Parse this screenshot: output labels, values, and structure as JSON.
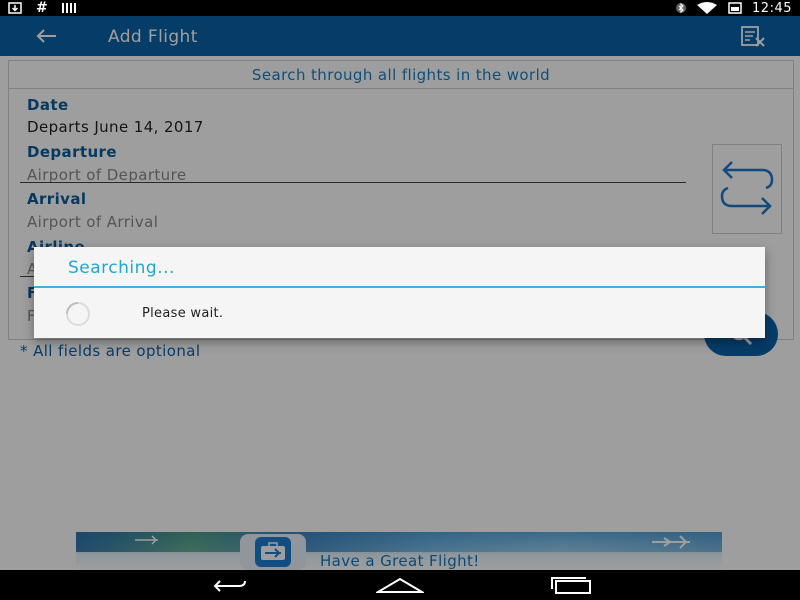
{
  "status_bar": {
    "time": "12:45",
    "left_icons": [
      "download-icon",
      "hash-icon",
      "barcode-icon"
    ],
    "right_icons": [
      "bluetooth-icon",
      "wifi-icon",
      "battery-icon"
    ]
  },
  "app_bar": {
    "title": "Add Flight",
    "back_icon": "arrow-left-icon",
    "action_icon": "clear-form-icon",
    "color": "#0b62a8"
  },
  "form": {
    "header": "Search through all flights in the world",
    "date": {
      "label": "Date",
      "value": "Departs June 14, 2017"
    },
    "departure": {
      "label": "Departure",
      "placeholder": "Airport of Departure"
    },
    "arrival": {
      "label": "Arrival",
      "placeholder": "Airport of Arrival"
    },
    "airline": {
      "label": "Airline",
      "placeholder": "A"
    },
    "flight": {
      "label": "F",
      "placeholder": "F"
    },
    "swap_icon": "swap-arrows-icon",
    "search_icon": "search-icon",
    "optional_note": "* All fields are optional"
  },
  "ad": {
    "text": "Have a Great Flight!",
    "icon": "airplane-suitcase-icon"
  },
  "dialog": {
    "title": "Searching...",
    "message": "Please wait.",
    "accent": "#33b5e5"
  },
  "nav_bar": {
    "buttons": [
      "back-nav-icon",
      "home-nav-icon",
      "recents-nav-icon"
    ]
  }
}
